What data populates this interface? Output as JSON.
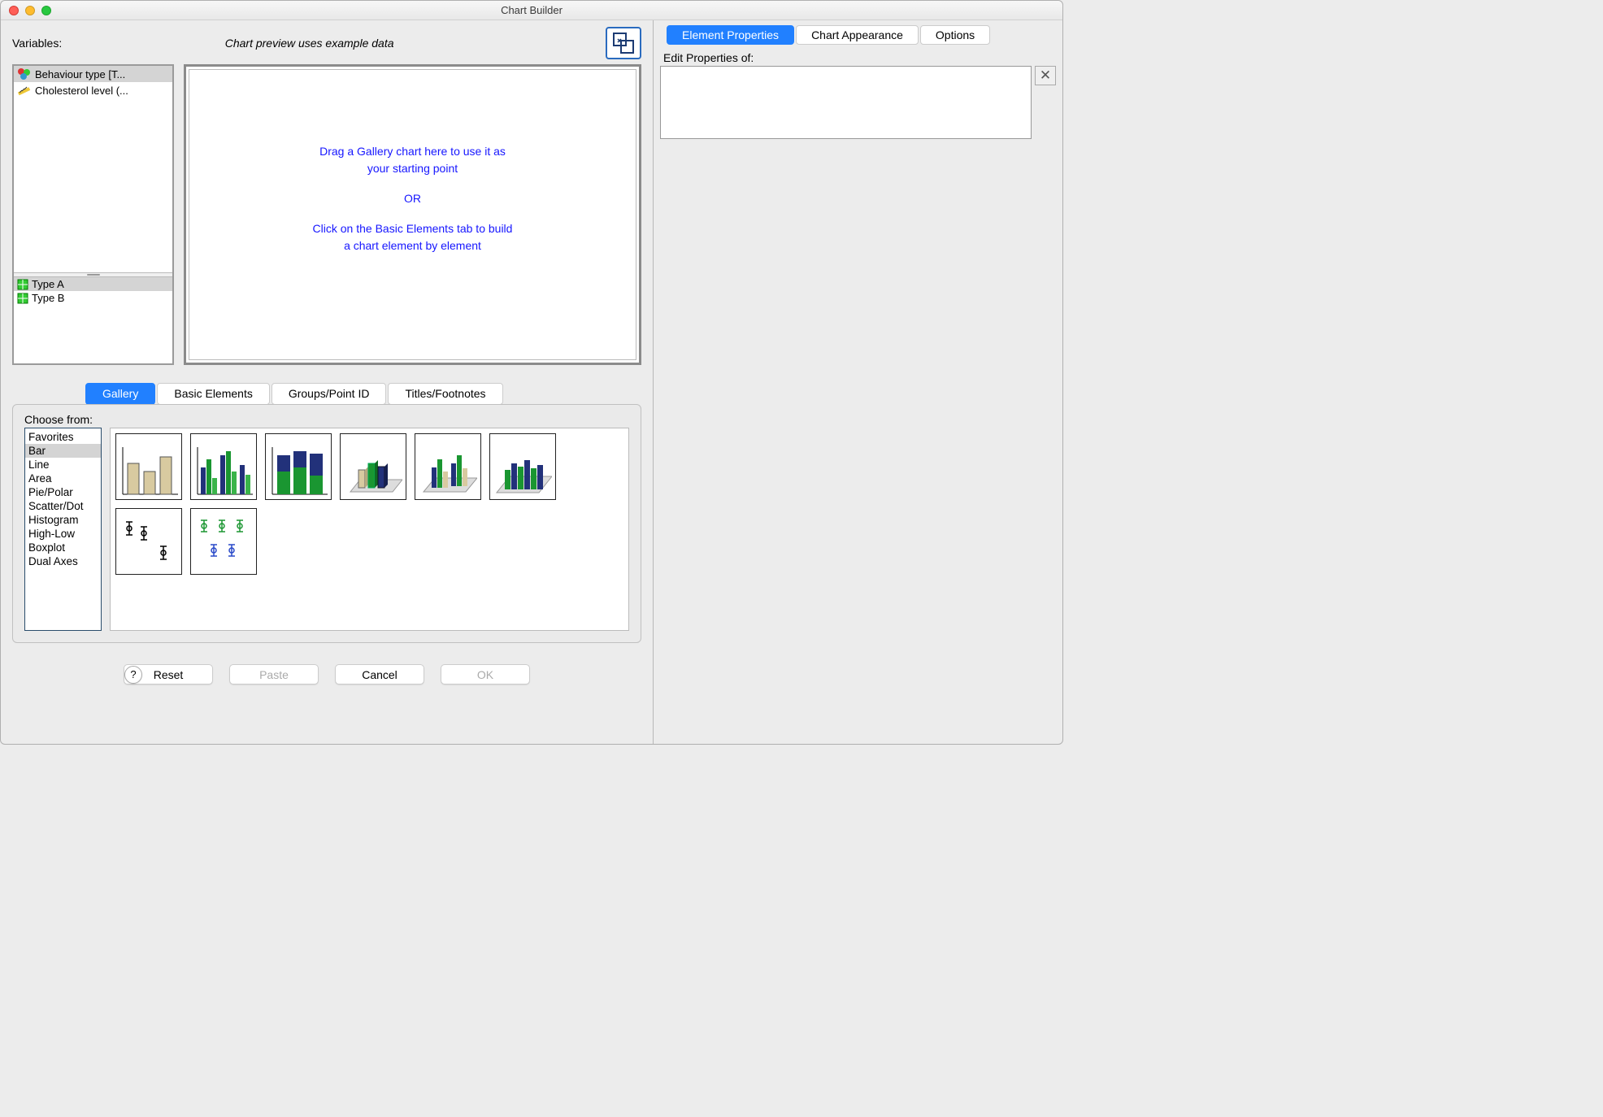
{
  "window": {
    "title": "Chart Builder"
  },
  "header": {
    "variables_label": "Variables:",
    "preview_note": "Chart preview uses example data"
  },
  "variables": [
    {
      "label": "Behaviour type [T...",
      "icon": "nominal",
      "selected": true
    },
    {
      "label": "Cholesterol level (...",
      "icon": "scale",
      "selected": false
    }
  ],
  "categories": [
    {
      "label": "Type A",
      "selected": true
    },
    {
      "label": "Type B",
      "selected": false
    }
  ],
  "preview": {
    "line1": "Drag a Gallery chart here to use it as",
    "line2": "your starting point",
    "or": "OR",
    "line3": "Click on the Basic Elements tab to build",
    "line4": "a chart element by element"
  },
  "tabs": {
    "items": [
      "Gallery",
      "Basic Elements",
      "Groups/Point ID",
      "Titles/Footnotes"
    ],
    "active": 0
  },
  "gallery": {
    "choose_label": "Choose from:",
    "list": [
      "Favorites",
      "Bar",
      "Line",
      "Area",
      "Pie/Polar",
      "Scatter/Dot",
      "Histogram",
      "High-Low",
      "Boxplot",
      "Dual Axes"
    ],
    "selected": 1,
    "thumbs": [
      "simple-bar",
      "clustered-bar",
      "stacked-bar",
      "3d-bar-1",
      "3d-bar-2",
      "3d-bar-3",
      "error-bar-simple",
      "error-bar-clustered"
    ]
  },
  "buttons": {
    "help": "?",
    "reset": "Reset",
    "paste": "Paste",
    "cancel": "Cancel",
    "ok": "OK"
  },
  "right": {
    "tabs": [
      "Element Properties",
      "Chart Appearance",
      "Options"
    ],
    "active": 0,
    "edit_label": "Edit Properties of:"
  }
}
